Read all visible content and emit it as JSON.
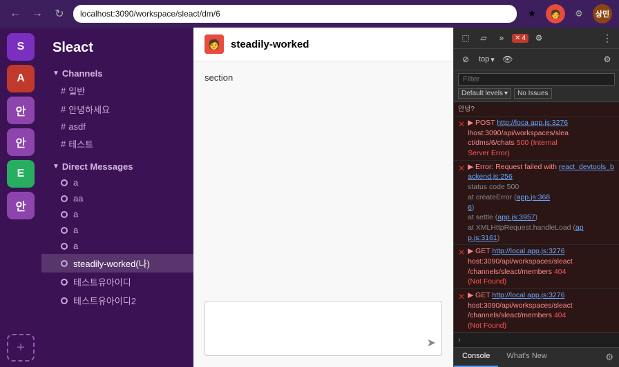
{
  "browser": {
    "url": "localhost:3090/workspace/sleact/dm/6",
    "back_label": "←",
    "forward_label": "→",
    "refresh_label": "↺",
    "user_label": "상민"
  },
  "icon_sidebar": {
    "items": [
      {
        "label": "S",
        "class": "avatar-s"
      },
      {
        "label": "A",
        "class": "avatar-a"
      },
      {
        "label": "안",
        "class": "avatar-an"
      },
      {
        "label": "안",
        "class": "avatar-an"
      },
      {
        "label": "E",
        "class": "avatar-e"
      },
      {
        "label": "안",
        "class": "avatar-an"
      }
    ],
    "add_label": "+"
  },
  "sidebar": {
    "app_name": "Sleact",
    "channels_header": "Channels",
    "channels": [
      {
        "name": "일반"
      },
      {
        "name": "안녕하세요"
      },
      {
        "name": "asdf"
      },
      {
        "name": "테스트"
      }
    ],
    "dm_header": "Direct Messages",
    "dms": [
      {
        "name": "a",
        "active": false
      },
      {
        "name": "aa",
        "active": false
      },
      {
        "name": "a",
        "active": false
      },
      {
        "name": "a",
        "active": false
      },
      {
        "name": "a",
        "active": false
      },
      {
        "name": "steadily-worked(나)",
        "active": true
      },
      {
        "name": "테스트유아이디",
        "active": false
      },
      {
        "name": "테스트유아이디2",
        "active": false
      }
    ]
  },
  "chat": {
    "title": "steadily-worked",
    "message_text": "section",
    "input_placeholder": "",
    "send_icon": "➤"
  },
  "devtools": {
    "error_count": "4",
    "top_label": "top",
    "filter_placeholder": "Filter",
    "default_levels_label": "Default levels",
    "no_issues_label": "No Issues",
    "entries": [
      {
        "type": "error",
        "text": "▶ POST http://localhost:3090/api/workspaces/sleact/dms/6/chats 500 (Internal Server Error)",
        "link": "app.js:3276"
      },
      {
        "type": "error",
        "text": "▶ Error: Request failed with react_devtools_backend.js:256\n  status code 500\n  at createError (app.js:3686)\n  at settle (app.js:3957)\n  at XMLHttpRequest.handleLoad (app.js:3161)"
      },
      {
        "type": "error",
        "text": "▶ GET http://localhost:3090/api/workspaces/sleact/channels/sleact/members 404 (Not Found)",
        "link": "app.js:3276"
      },
      {
        "type": "error",
        "text": "▶ GET http://localhost:3090/api/workspaces/sleact/channels/sleact/members 404 (Not Found)",
        "link": "app.js:3276"
      }
    ],
    "korean_text": "안녕?",
    "tabs": [
      {
        "label": "Console",
        "active": true
      },
      {
        "label": "What's New",
        "active": false
      }
    ]
  }
}
